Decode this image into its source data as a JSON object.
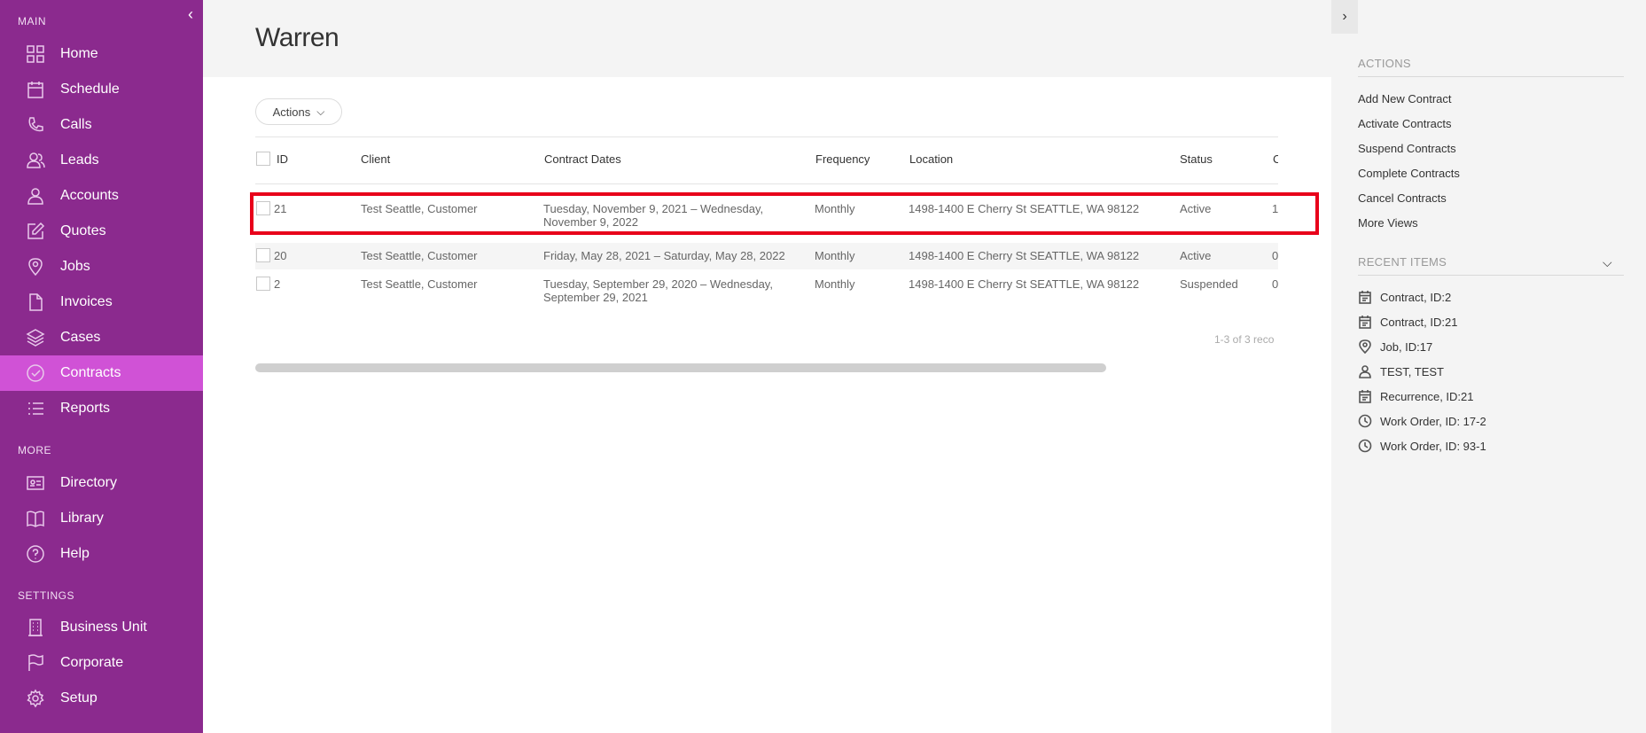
{
  "sidebar": {
    "collapse_icon": "chevron-left-icon",
    "sections": {
      "main": "MAIN",
      "more": "MORE",
      "settings": "SETTINGS"
    },
    "items": [
      {
        "label": "Home",
        "icon": "grid-icon"
      },
      {
        "label": "Schedule",
        "icon": "calendar-icon"
      },
      {
        "label": "Calls",
        "icon": "phone-icon"
      },
      {
        "label": "Leads",
        "icon": "people-icon"
      },
      {
        "label": "Accounts",
        "icon": "user-icon"
      },
      {
        "label": "Quotes",
        "icon": "edit-icon"
      },
      {
        "label": "Jobs",
        "icon": "map-pin-icon"
      },
      {
        "label": "Invoices",
        "icon": "document-icon"
      },
      {
        "label": "Cases",
        "icon": "layers-icon"
      },
      {
        "label": "Contracts",
        "icon": "check-circle-icon",
        "active": true
      },
      {
        "label": "Reports",
        "icon": "list-icon"
      },
      {
        "label": "Directory",
        "icon": "id-card-icon"
      },
      {
        "label": "Library",
        "icon": "book-icon"
      },
      {
        "label": "Help",
        "icon": "help-icon"
      },
      {
        "label": "Business Unit",
        "icon": "building-icon"
      },
      {
        "label": "Corporate",
        "icon": "flag-icon"
      },
      {
        "label": "Setup",
        "icon": "gear-icon"
      }
    ]
  },
  "header": {
    "title": "Warren"
  },
  "toolbar": {
    "actions_label": "Actions"
  },
  "table": {
    "columns": [
      "ID",
      "Client",
      "Contract Dates",
      "Frequency",
      "Location",
      "Status",
      "C"
    ],
    "rows": [
      {
        "id": "21",
        "client": "Test Seattle, Customer",
        "dates_line1": "Tuesday, November 9, 2021 – Wednesday,",
        "dates_line2": "November 9, 2022",
        "frequency": "Monthly",
        "location": "1498-1400 E Cherry St SEATTLE, WA 98122",
        "status": "Active",
        "extra": "1",
        "highlighted": true
      },
      {
        "id": "20",
        "client": "Test Seattle, Customer",
        "dates_line1": "Friday, May 28, 2021 – Saturday, May 28, 2022",
        "dates_line2": "",
        "frequency": "Monthly",
        "location": "1498-1400 E Cherry St SEATTLE, WA 98122",
        "status": "Active",
        "extra": "0"
      },
      {
        "id": "2",
        "client": "Test Seattle, Customer",
        "dates_line1": "Tuesday, September 29, 2020 – Wednesday,",
        "dates_line2": "September 29, 2021",
        "frequency": "Monthly",
        "location": "1498-1400 E Cherry St SEATTLE, WA 98122",
        "status": "Suspended",
        "extra": "0"
      }
    ],
    "pager": "1-3 of 3 reco"
  },
  "right_panel": {
    "toggle_icon": "chevron-right-icon",
    "actions_title": "ACTIONS",
    "actions": [
      "Add New Contract",
      "Activate Contracts",
      "Suspend Contracts",
      "Complete Contracts",
      "Cancel Contracts",
      "More Views"
    ],
    "recent_title": "RECENT ITEMS",
    "recent_toggle_icon": "chevron-down-icon",
    "recent": [
      {
        "label": "Contract, ID:2",
        "icon": "calendar-icon"
      },
      {
        "label": "Contract, ID:21",
        "icon": "calendar-icon"
      },
      {
        "label": "Job, ID:17",
        "icon": "map-pin-icon"
      },
      {
        "label": "TEST, TEST",
        "icon": "person-icon"
      },
      {
        "label": "Recurrence, ID:21",
        "icon": "calendar-icon"
      },
      {
        "label": "Work Order, ID: 17-2",
        "icon": "clock-icon"
      },
      {
        "label": "Work Order, ID: 93-1",
        "icon": "clock-icon"
      }
    ]
  },
  "colors": {
    "sidebar": "#8b2a8e",
    "active": "#d052d6",
    "highlight": "#e8001a"
  }
}
